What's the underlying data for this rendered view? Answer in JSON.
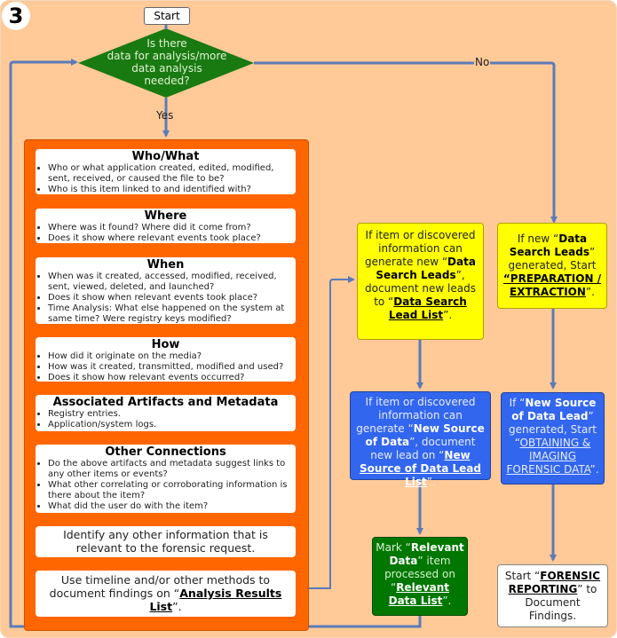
{
  "step_number": "3",
  "start_label": "Start",
  "decision": {
    "text": "Is there data for analysis/more data analysis needed?",
    "line1": "Is there",
    "line2": "data for analysis/more",
    "line3": "data analysis",
    "line4": "needed?",
    "yes_label": "Yes",
    "no_label": "No"
  },
  "analysis_cards": [
    {
      "title": "Who/What",
      "bullets": [
        "Who or what application created, edited, modified, sent, received, or caused the file to be?",
        "Who is this item linked to and identified with?"
      ]
    },
    {
      "title": "Where",
      "bullets": [
        "Where was it found? Where did it come from?",
        "Does it show where relevant events took place?"
      ]
    },
    {
      "title": "When",
      "bullets": [
        "When was it created, accessed, modified, received, sent, viewed, deleted, and launched?",
        "Does it show when relevant events took place?",
        "Time Analysis: What else happened on the system at same time?  Were registry keys modified?"
      ]
    },
    {
      "title": "How",
      "bullets": [
        "How did it originate on the media?",
        "How was it created, transmitted, modified and used?",
        "Does it show how relevant events occurred?"
      ]
    },
    {
      "title": "Associated Artifacts and Metadata",
      "bullets": [
        "Registry entries.",
        "Application/system logs."
      ]
    },
    {
      "title": "Other Connections",
      "bullets": [
        "Do the above artifacts and metadata suggest links to any other items or events?",
        "What other correlating or corroborating information is there about the item?",
        "What did the user do with the item?"
      ]
    }
  ],
  "identify_card": "Identify any other information that is relevant to the forensic request.",
  "document_card": {
    "prefix": "Use timeline and/or other methods to document findings on “",
    "link": "Analysis Results List",
    "suffix": "”."
  },
  "yellow_left": {
    "p1": "If item or discovered information can generate new “",
    "b1": "Data Search Leads",
    "p2": "”, document new leads to “",
    "link": "Data Search Lead List",
    "p3": "”."
  },
  "yellow_right": {
    "p1": "If new “",
    "b1": "Data Search Leads",
    "p2": "” generated, Start ",
    "link": "“PREPARATION / EXTRACTION",
    "p3": "”."
  },
  "blue_left": {
    "p1": "If item or discovered information can generate “",
    "b1": "New Source of Data",
    "p2": "”, document new lead on “",
    "link": "New Source of Data Lead List",
    "p3": "”."
  },
  "blue_right": {
    "p1": "If “",
    "b1": "New Source of Data Lead",
    "p2": "” generated, Start “",
    "link": "OBTAINING & IMAGING FORENSIC DATA",
    "p3": "”."
  },
  "green_box": {
    "p1": "Mark “",
    "b1": "Relevant Data",
    "p2": "” item processed on “",
    "link": "Relevant Data List",
    "p3": "”."
  },
  "white_box": {
    "p1": "Start “",
    "link": "FORENSIC REPORTING",
    "p2": "” to Document Findings."
  },
  "colors": {
    "background": "#ffc998",
    "decision": "#1a7a12",
    "analysis_container": "#ff6600",
    "data_search": "#ffff00",
    "new_source": "#3366ee",
    "relevant": "#007700",
    "connector": "#5b7bb8"
  }
}
